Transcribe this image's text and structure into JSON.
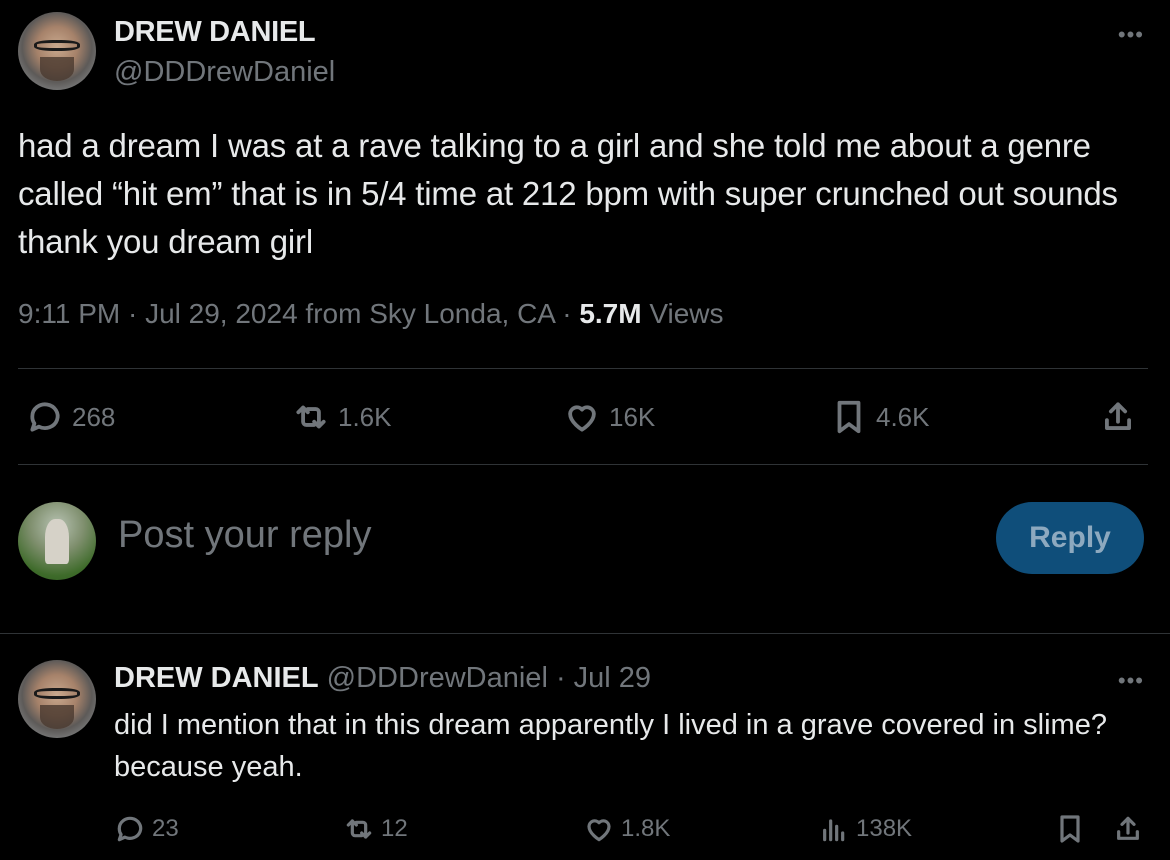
{
  "post": {
    "author_name": "DREW DANIEL",
    "author_handle": "@DDDrewDaniel",
    "more_icon": "more-icon",
    "text": "had a dream I was at a rave talking to a girl and she told me about a genre called “hit em” that is in 5/4 time at 212 bpm with super crunched out sounds thank you dream girl",
    "time": "9:11 PM · Jul 29, 2024 from Sky Londa, CA · ",
    "views_count": "5.7M",
    "views_label": " Views",
    "actions": {
      "replies": "268",
      "reposts": "1.6K",
      "likes": "16K",
      "bookmarks": "4.6K"
    }
  },
  "composer": {
    "placeholder": "Post your reply",
    "reply_button": "Reply"
  },
  "reply": {
    "author_name": "DREW DANIEL",
    "author_handle": "@DDDrewDaniel",
    "separator": " · ",
    "date": "Jul 29",
    "text": "did I mention that in this dream apparently I lived in a grave covered in slime? because yeah.",
    "actions": {
      "replies": "23",
      "reposts": "12",
      "likes": "1.8K",
      "views": "138K"
    }
  },
  "colors": {
    "background": "#000000",
    "text": "#e7e9ea",
    "muted": "#71767b",
    "divider": "#2f3336",
    "reply_button_bg": "#0f4e7a"
  }
}
